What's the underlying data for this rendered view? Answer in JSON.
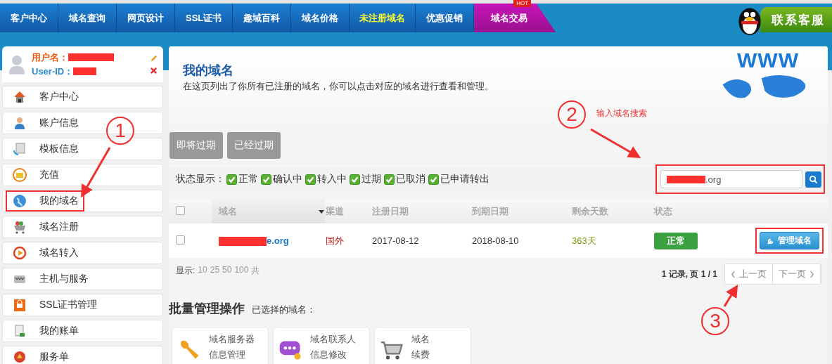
{
  "nav": {
    "tabs": [
      {
        "label": "客户中心",
        "kind": "normal"
      },
      {
        "label": "域名查询",
        "kind": "normal"
      },
      {
        "label": "网页设计",
        "kind": "normal"
      },
      {
        "label": "SSL证书",
        "kind": "normal"
      },
      {
        "label": "趣域百科",
        "kind": "normal"
      },
      {
        "label": "域名价格",
        "kind": "normal"
      },
      {
        "label": "未注册域名",
        "kind": "highlight"
      },
      {
        "label": "优惠促销",
        "kind": "normal"
      },
      {
        "label": "域名交易",
        "kind": "hot",
        "badge": "HOT"
      }
    ],
    "contact": "联系客服"
  },
  "user": {
    "username_label": "用户名：",
    "userid_label": "User-ID："
  },
  "sidebar": {
    "items": [
      {
        "label": "客户中心",
        "annotated": false
      },
      {
        "label": "账户信息",
        "annotated": false
      },
      {
        "label": "模板信息",
        "annotated": false
      },
      {
        "label": "充值",
        "annotated": false
      },
      {
        "label": "我的域名",
        "annotated": true
      },
      {
        "label": "域名注册",
        "annotated": false
      },
      {
        "label": "域名转入",
        "annotated": false
      },
      {
        "label": "主机与服务",
        "annotated": false
      },
      {
        "label": "SSL证书管理",
        "annotated": false
      },
      {
        "label": "我的账单",
        "annotated": false
      },
      {
        "label": "服务单",
        "annotated": false
      }
    ]
  },
  "main": {
    "title": "我的域名",
    "description": "在这页列出了你所有已注册的域名，你可以点击对应的域名进行查看和管理。",
    "banner": "WWW",
    "filter_buttons": [
      "即将过期",
      "已经过期"
    ],
    "status_filter": {
      "label": "状态显示：",
      "options": [
        {
          "label": "正常",
          "checked": true
        },
        {
          "label": "确认中",
          "checked": true
        },
        {
          "label": "转入中",
          "checked": true
        },
        {
          "label": "过期",
          "checked": true
        },
        {
          "label": "已取消",
          "checked": true
        },
        {
          "label": "已申请转出",
          "checked": true
        }
      ]
    },
    "search": {
      "value": ".org",
      "annotated": true
    },
    "table": {
      "select_all": false,
      "columns": [
        "域名",
        "渠道",
        "注册日期",
        "到期日期",
        "剩余天数",
        "状态"
      ],
      "rows": [
        {
          "checked": false,
          "domain": "e.org",
          "channel": "国外",
          "registered": "2017-08-12",
          "expires": "2018-08-10",
          "remaining": "363天",
          "status": "正常",
          "action": "管理域名",
          "action_annotated": true
        }
      ]
    },
    "page_size": {
      "label": "显示:",
      "options": [
        "10",
        "25",
        "50",
        "100"
      ],
      "suffix": "共"
    },
    "pagination": {
      "summary": "1 记录, 页 1 / 1",
      "prev": "上一页",
      "next": "下一页"
    },
    "batch": {
      "title": "批量管理操作",
      "selected_label": "已选择的域名：",
      "actions": [
        {
          "lines": [
            "域名服务器",
            "信息管理"
          ]
        },
        {
          "lines": [
            "域名联系人",
            "信息修改"
          ]
        },
        {
          "lines": [
            "域名",
            "续费"
          ]
        }
      ]
    }
  },
  "annotations": {
    "steps": [
      "1",
      "2",
      "3"
    ],
    "note": "输入域名搜索"
  }
}
